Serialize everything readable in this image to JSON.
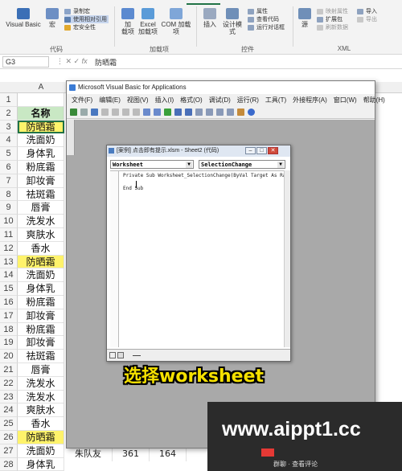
{
  "ribbon": {
    "items": {
      "visual_basic": "Visual Basic",
      "macro": "宏",
      "record_macro": "录制宏",
      "relative_ref": "使用相对引用",
      "macro_security": "宏安全性",
      "addins": "加\n载项",
      "excel_addins": "Excel\n加载项",
      "com_addins": "COM 加载项",
      "insert": "插入",
      "design_mode": "设计模式",
      "properties": "属性",
      "view_code": "查看代码",
      "run_dialog": "运行对话框",
      "source": "源",
      "map_props": "映射属性",
      "expansion_packs": "扩展包",
      "refresh_data": "刷新数据",
      "import": "导入",
      "export": "导出"
    },
    "groups": {
      "code": "代码",
      "addins": "加载项",
      "controls": "控件",
      "xml": "XML"
    },
    "accent": "#217346"
  },
  "formula_bar": {
    "name_box": "G3",
    "formula": "防晒霜"
  },
  "sheet": {
    "column_header": "A",
    "header_cell": "名称",
    "rows": [
      {
        "n": "1",
        "v": "",
        "hl": false
      },
      {
        "n": "2",
        "v": "名称",
        "hl": false
      },
      {
        "n": "3",
        "v": "防晒霜",
        "hl": true
      },
      {
        "n": "4",
        "v": "洗面奶",
        "hl": false
      },
      {
        "n": "5",
        "v": "身体乳",
        "hl": false
      },
      {
        "n": "6",
        "v": "粉底霜",
        "hl": false
      },
      {
        "n": "7",
        "v": "卸妆膏",
        "hl": false
      },
      {
        "n": "8",
        "v": "祛斑霜",
        "hl": false
      },
      {
        "n": "9",
        "v": "唇膏",
        "hl": false
      },
      {
        "n": "10",
        "v": "洗发水",
        "hl": false
      },
      {
        "n": "11",
        "v": "爽肤水",
        "hl": false
      },
      {
        "n": "12",
        "v": "香水",
        "hl": false
      },
      {
        "n": "13",
        "v": "防晒霜",
        "hl": true
      },
      {
        "n": "14",
        "v": "洗面奶",
        "hl": false
      },
      {
        "n": "15",
        "v": "身体乳",
        "hl": false
      },
      {
        "n": "16",
        "v": "粉底霜",
        "hl": false
      },
      {
        "n": "17",
        "v": "卸妆膏",
        "hl": false
      },
      {
        "n": "18",
        "v": "粉底霜",
        "hl": false
      },
      {
        "n": "19",
        "v": "卸妆膏",
        "hl": false
      },
      {
        "n": "20",
        "v": "祛斑霜",
        "hl": false
      },
      {
        "n": "21",
        "v": "唇膏",
        "hl": false
      },
      {
        "n": "22",
        "v": "洗发水",
        "hl": false
      },
      {
        "n": "23",
        "v": "洗发水",
        "hl": false
      },
      {
        "n": "24",
        "v": "爽肤水",
        "hl": false
      },
      {
        "n": "25",
        "v": "香水",
        "hl": false
      },
      {
        "n": "26",
        "v": "防晒霜",
        "hl": true
      },
      {
        "n": "27",
        "v": "洗面奶",
        "hl": false
      },
      {
        "n": "28",
        "v": "身体乳",
        "hl": false
      }
    ],
    "extra_row": {
      "b": "朱队友",
      "c": "361",
      "d": "164"
    }
  },
  "vba": {
    "title": "Microsoft Visual Basic for Applications",
    "menu": [
      "文件(F)",
      "编辑(E)",
      "视图(V)",
      "插入(I)",
      "格式(O)",
      "调试(D)",
      "运行(R)",
      "工具(T)",
      "外接程序(A)",
      "窗口(W)",
      "帮助(H)"
    ],
    "code_window": {
      "title": "[案例] 点击即有提示.xlsm - Sheet2 (代码)",
      "object_dropdown": "Worksheet",
      "proc_dropdown": "SelectionChange",
      "lines": [
        "Private Sub Worksheet_SelectionChange(ByVal Target As Ra",
        "",
        "End Sub"
      ]
    }
  },
  "caption": "选择worksheet",
  "watermark": {
    "url": "www.aippt1.cc",
    "sub": "群聊 · 查看评论"
  }
}
